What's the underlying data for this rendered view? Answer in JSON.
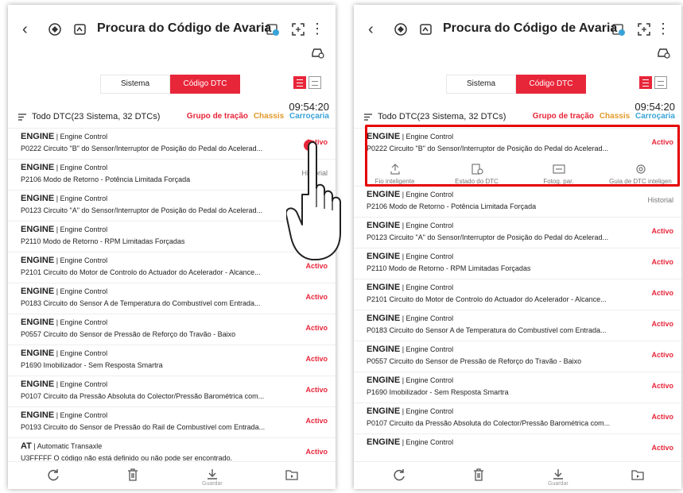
{
  "header": {
    "title": "Procura do Código de Avaria",
    "back": "‹",
    "menu": "⋮"
  },
  "tabs": [
    {
      "label": "Sistema",
      "active": false
    },
    {
      "label": "Código DTC",
      "active": true
    }
  ],
  "time": "09:54:20",
  "filter": {
    "label": "Todo DTC(23 Sistema, 32 DTCs)",
    "cat_powertrain": "Grupo de tração",
    "cat_chassis": "Chassis",
    "cat_body": "Carroçaria",
    "colors": {
      "powertrain": "#e8263a",
      "chassis": "#e39a2b",
      "body": "#3aa3d6"
    }
  },
  "left_rows": [
    {
      "sys": "ENGINE",
      "sub": "Engine Control",
      "desc": "P0222 Circuito \"B\" do Sensor/Interruptor de Posição do Pedal do Acelerad...",
      "status": "Activo"
    },
    {
      "sys": "ENGINE",
      "sub": "Engine Control",
      "desc": "P2106 Modo de Retorno - Potência Limitada Forçada",
      "status": "Historial"
    },
    {
      "sys": "ENGINE",
      "sub": "Engine Control",
      "desc": "P0123 Circuito \"A\" do Sensor/Interruptor de Posição do Pedal do Acelerad...",
      "status": ""
    },
    {
      "sys": "ENGINE",
      "sub": "Engine Control",
      "desc": "P2110 Modo de Retorno - RPM Limitadas Forçadas",
      "status": ""
    },
    {
      "sys": "ENGINE",
      "sub": "Engine Control",
      "desc": "P2101 Circuito do Motor de Controlo do Actuador do Acelerador - Alcance...",
      "status": "Activo"
    },
    {
      "sys": "ENGINE",
      "sub": "Engine Control",
      "desc": "P0183 Circuito do Sensor A de Temperatura do Combustível com Entrada...",
      "status": "Activo"
    },
    {
      "sys": "ENGINE",
      "sub": "Engine Control",
      "desc": "P0557 Circuito do Sensor de Pressão de Reforço do Travão - Baixo",
      "status": "Activo"
    },
    {
      "sys": "ENGINE",
      "sub": "Engine Control",
      "desc": "P1690 Imobilizador - Sem Resposta Smartra",
      "status": "Activo"
    },
    {
      "sys": "ENGINE",
      "sub": "Engine Control",
      "desc": "P0107 Circuito da Pressão Absoluta do Colector/Pressão Barométrica com...",
      "status": "Activo"
    },
    {
      "sys": "ENGINE",
      "sub": "Engine Control",
      "desc": "P0193 Circuito do Sensor de Pressão do Rail de Combustível com Entrada...",
      "status": "Activo"
    },
    {
      "sys": "AT",
      "sub": "Automatic Transaxle",
      "desc": "U3FFFFF O código não está definido ou não pode ser encontrado.",
      "status": "Activo"
    }
  ],
  "right_rows": [
    {
      "sys": "ENGINE",
      "sub": "Engine Control",
      "desc": "P0222 Circuito \"B\" do Sensor/Interruptor de Posição do Pedal do Acelerad...",
      "status": "Activo"
    },
    {
      "sys": "ENGINE",
      "sub": "Engine Control",
      "desc": "P2106 Modo de Retorno - Potência Limitada Forçada",
      "status": "Historial"
    },
    {
      "sys": "ENGINE",
      "sub": "Engine Control",
      "desc": "P0123 Circuito \"A\" do Sensor/Interruptor de Posição do Pedal do Acelerad...",
      "status": "Activo"
    },
    {
      "sys": "ENGINE",
      "sub": "Engine Control",
      "desc": "P2110 Modo de Retorno - RPM Limitadas Forçadas",
      "status": "Activo"
    },
    {
      "sys": "ENGINE",
      "sub": "Engine Control",
      "desc": "P2101 Circuito do Motor de Controlo do Actuador do Acelerador - Alcance...",
      "status": "Activo"
    },
    {
      "sys": "ENGINE",
      "sub": "Engine Control",
      "desc": "P0183 Circuito do Sensor A de Temperatura do Combustível com Entrada...",
      "status": "Activo"
    },
    {
      "sys": "ENGINE",
      "sub": "Engine Control",
      "desc": "P0557 Circuito do Sensor de Pressão de Reforço do Travão - Baixo",
      "status": "Activo"
    },
    {
      "sys": "ENGINE",
      "sub": "Engine Control",
      "desc": "P1690 Imobilizador - Sem Resposta Smartra",
      "status": "Activo"
    },
    {
      "sys": "ENGINE",
      "sub": "Engine Control",
      "desc": "P0107 Circuito da Pressão Absoluta do Colector/Pressão Barométrica com...",
      "status": "Activo"
    },
    {
      "sys": "ENGINE",
      "sub": "Engine Control",
      "desc": "",
      "status": "Activo"
    }
  ],
  "actions": [
    "Fio inteligente",
    "Estado do DTC",
    "Fotog. par.",
    "Guia de DTC inteligen"
  ],
  "bottom": {
    "save_label": "Guardar"
  },
  "accent": "#e8263a"
}
